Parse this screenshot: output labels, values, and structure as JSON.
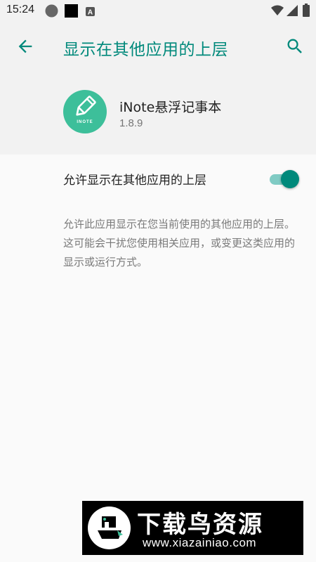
{
  "status_bar": {
    "time": "15:24",
    "icons": [
      "circle-notification-icon",
      "square-notification-icon",
      "a-notification-icon",
      "wifi-icon",
      "signal-icon",
      "battery-icon"
    ]
  },
  "toolbar": {
    "title": "显示在其他应用的上层",
    "back_icon": "arrow-back-icon",
    "search_icon": "search-icon"
  },
  "app": {
    "name": "iNote悬浮记事本",
    "version": "1.8.9",
    "icon_label": "INOTE",
    "icon_color": "#3dbf9a"
  },
  "permission": {
    "label": "允许显示在其他应用的上层",
    "enabled": true,
    "description": "允许此应用显示在您当前使用的其他应用的上层。这可能会干扰您使用相关应用，或变更这类应用的显示或运行方式。"
  },
  "watermark": {
    "title": "下载鸟资源",
    "url": "www.xiazainiao.com"
  },
  "colors": {
    "accent": "#00897b",
    "toggle_track": "#80cbc4",
    "header_bg": "#f2f2f2",
    "content_bg": "#fafafa"
  }
}
